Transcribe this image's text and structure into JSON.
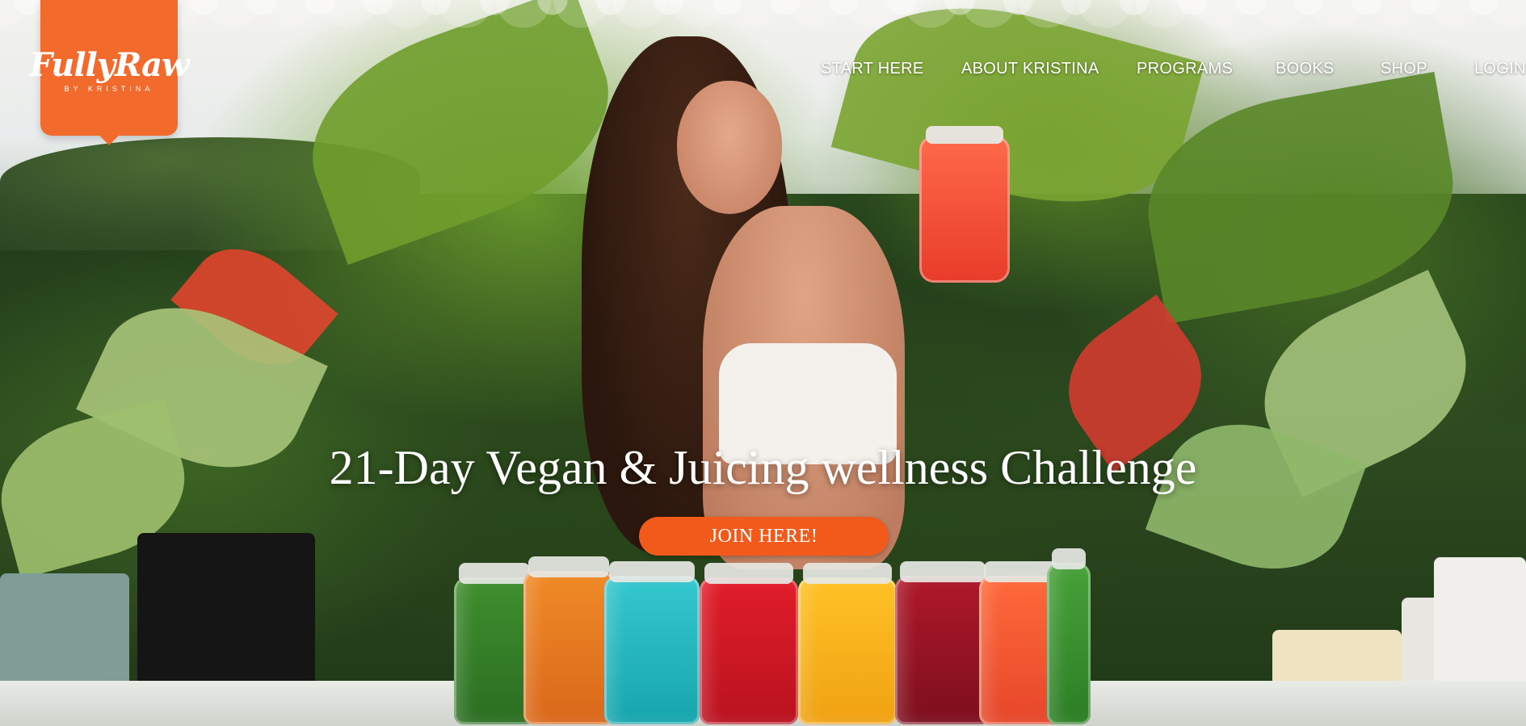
{
  "brand": {
    "logo_word": "FullyRaw",
    "logo_tagline": "BY KRISTINA",
    "color": "#f26a2c"
  },
  "nav": {
    "items": [
      {
        "label": "START HERE"
      },
      {
        "label": "ABOUT KRISTINA"
      },
      {
        "label": "PROGRAMS"
      },
      {
        "label": "BOOKS"
      },
      {
        "label": "SHOP"
      },
      {
        "label": "LOGIN"
      }
    ]
  },
  "hero": {
    "headline": "21-Day Vegan & Juicing wellness Challenge",
    "cta_label": "JOIN HERE!",
    "cta_color": "#f25a1c"
  }
}
